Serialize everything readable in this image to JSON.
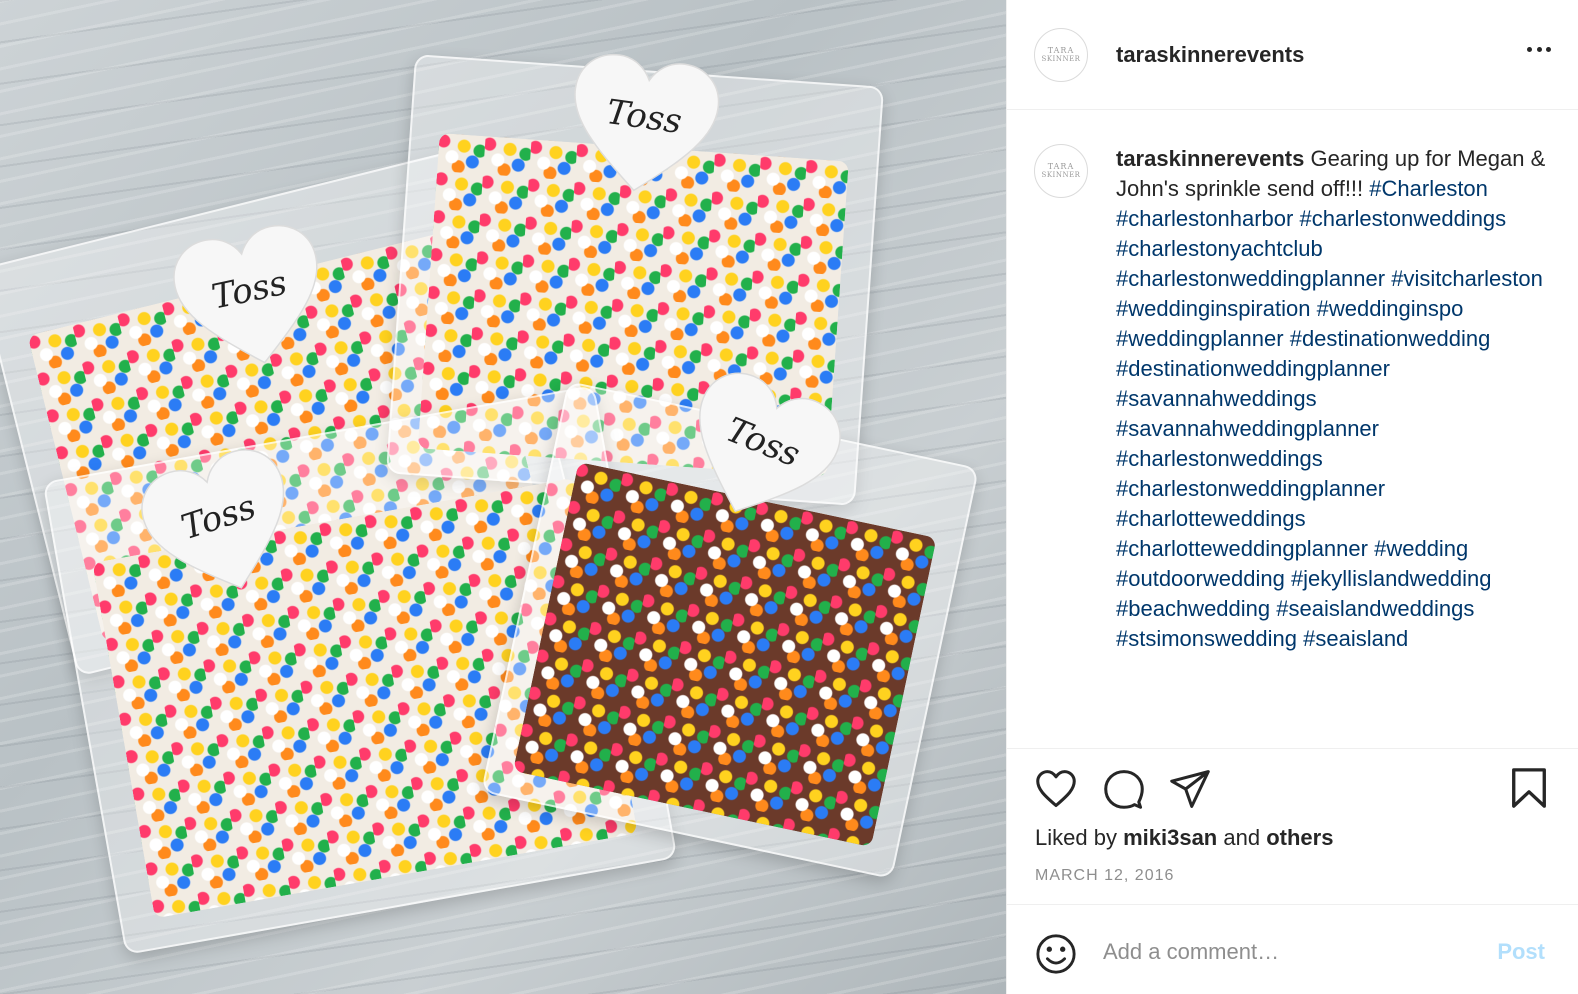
{
  "post": {
    "image_tag_text": "Toss",
    "author": {
      "username": "taraskinnerevents",
      "avatar_line1": "TARA",
      "avatar_line2": "SKINNER"
    },
    "caption": {
      "username": "taraskinnerevents",
      "text": "Gearing up for Megan & John's sprinkle send off!!!",
      "hashtags": [
        "#Charleston",
        "#charlestonharbor",
        "#charlestonweddings",
        "#charlestonyachtclub",
        "#charlestonweddingplanner",
        "#visitcharleston",
        "#weddinginspiration",
        "#weddinginspo",
        "#weddingplanner",
        "#destinationwedding",
        "#destinationweddingplanner",
        "#savannahweddings",
        "#savannahweddingplanner",
        "#charlestonweddings",
        "#charlestonweddingplanner",
        "#charlotteweddings",
        "#charlotteweddingplanner",
        "#wedding",
        "#outdoorwedding",
        "#jekyllislandwedding",
        "#beachwedding",
        "#seaislandweddings",
        "#stsimonswedding",
        "#seaisland"
      ]
    },
    "likes": {
      "prefix": "Liked by",
      "user": "miki3san",
      "joiner": "and",
      "others": "others"
    },
    "date": "MARCH 12, 2016",
    "comment": {
      "placeholder": "Add a comment…",
      "post_label": "Post"
    },
    "icons": [
      "more-options-icon",
      "heart-icon",
      "comment-icon",
      "share-icon",
      "bookmark-icon",
      "emoji-icon"
    ],
    "colors": {
      "hashtag": "#00376b",
      "text": "#262626",
      "muted": "#8e8e8e",
      "post_disabled": "#b2dffc",
      "divider": "#efefef"
    }
  }
}
